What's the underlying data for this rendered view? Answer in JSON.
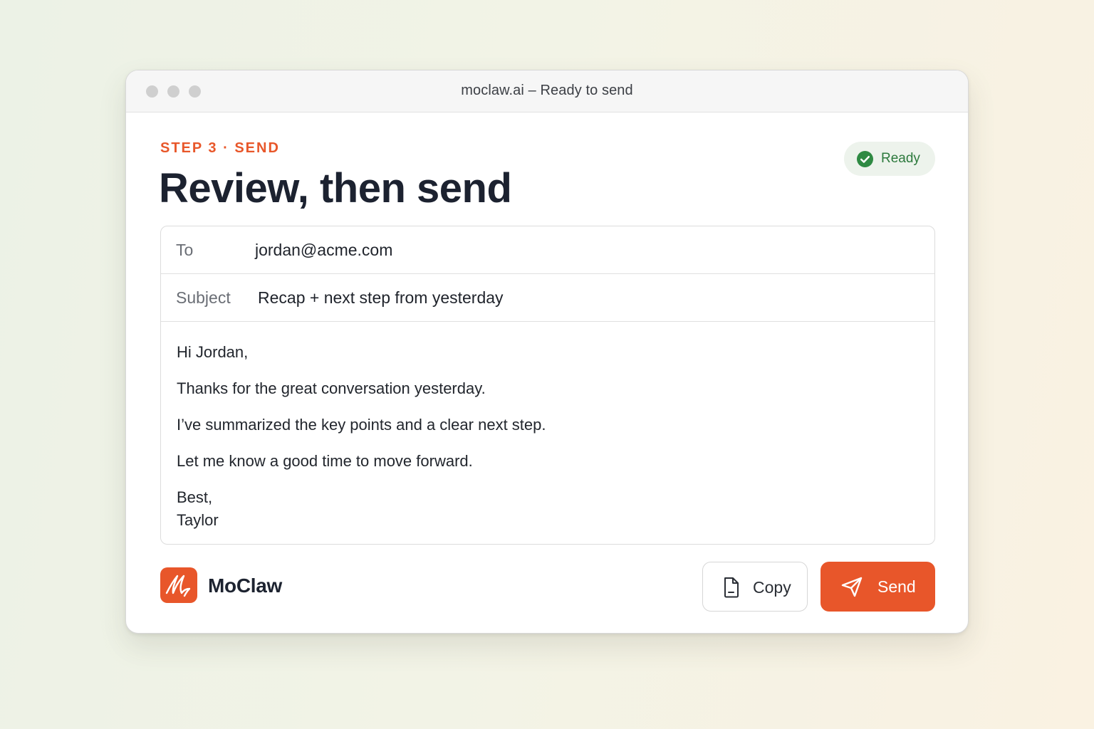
{
  "window": {
    "title": "moclaw.ai – Ready to send"
  },
  "header": {
    "step_label": "STEP 3 · SEND",
    "title": "Review, then send",
    "status": "Ready"
  },
  "email": {
    "to_label": "To",
    "to_value": "jordan@acme.com",
    "subject_label": "Subject",
    "subject_value": "Recap + next step from yesterday",
    "body": [
      "Hi Jordan,",
      "Thanks for the great conversation yesterday.",
      "I’ve summarized the key points and a clear next step.",
      "Let me know a good time to move forward.",
      "Best,",
      "Taylor"
    ]
  },
  "footer": {
    "brand_name": "MoClaw",
    "copy_label": "Copy",
    "send_label": "Send"
  },
  "icons": {
    "window_controls": [
      "window-close-dot",
      "window-minimize-dot",
      "window-zoom-dot"
    ],
    "status": "check-circle-icon",
    "logo": "moclaw-logo-icon",
    "copy": "document-icon",
    "send": "paper-plane-icon"
  },
  "colors": {
    "accent": "#e8562a",
    "ready_green": "#2d7a3d",
    "ready_bg": "#edf3ec",
    "text_dark": "#1c2230"
  }
}
